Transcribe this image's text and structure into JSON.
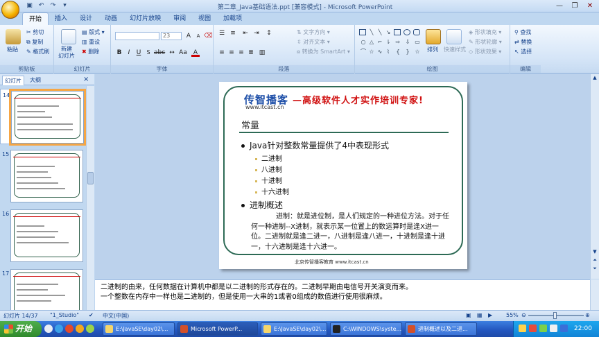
{
  "window": {
    "title": "第二章_Java基础语法.ppt [兼容模式] - Microsoft PowerPoint"
  },
  "tabs": [
    "开始",
    "插入",
    "设计",
    "动画",
    "幻灯片放映",
    "审阅",
    "视图",
    "加载项"
  ],
  "ribbon": {
    "clipboard": {
      "label": "剪贴板",
      "paste": "粘贴",
      "cut": "剪切",
      "copy": "复制",
      "format_painter": "格式刷"
    },
    "slides": {
      "label": "幻灯片",
      "new_slide": "新建\n幻灯片",
      "layout": "版式",
      "reset": "重设",
      "delete": "删除"
    },
    "font": {
      "label": "字体",
      "font_size": "23"
    },
    "paragraph": {
      "label": "段落",
      "text_direction": "文字方向",
      "align_text": "对齐文本",
      "smartart": "转换为 SmartArt"
    },
    "drawing": {
      "label": "绘图",
      "arrange": "排列",
      "quick_styles": "快速样式",
      "shape_fill": "形状填充",
      "shape_outline": "形状轮廓",
      "shape_effects": "形状效果"
    },
    "editing": {
      "label": "编辑",
      "find": "查找",
      "replace": "替换",
      "select": "选择"
    }
  },
  "pane": {
    "tab_slides": "幻灯片",
    "tab_outline": "大纲",
    "close": "×",
    "thumb_numbers": [
      "14",
      "15",
      "16",
      "17"
    ]
  },
  "slide": {
    "brand": "传智播客",
    "brand_url": "www.itcast.cn",
    "slogan": "—高级软件人才实作培训专家!",
    "title": "常量",
    "bullet1": "Java针对整数常量提供了4中表现形式",
    "sub_bullets": [
      "二进制",
      "八进制",
      "十进制",
      "十六进制"
    ],
    "bullet2": "进制概述",
    "paragraph": "进制：就是进位制，是人们规定的一种进位方法。对于任何一种进制--X进制，就表示某一位置上的数运算时是逢X进一位。二进制就是逢二进一，八进制是逢八进一，十进制是逢十进一，十六进制是逢十六进一。",
    "footer": "北京传智播客教育 www.itcast.cn"
  },
  "notes": {
    "line1": "二进制的由来，任何数据在计算机中都是以二进制的形式存在的。二进制早期由电信号开关演变而来。",
    "line2": "一个整数在内存中一样也是二进制的，但是使用一大串的1或者0组成的数值进行使用很麻烦。"
  },
  "status": {
    "slide": "幻灯片 14/37",
    "theme": "\"1_Studio\"",
    "lang": "中文(中国)",
    "zoom": "55%"
  },
  "taskbar": {
    "start": "开始",
    "items": [
      "E:\\JavaSE\\day02\\...",
      "Microsoft PowerP...",
      "E:\\JavaSE\\day02\\...",
      "C:\\WINDOWS\\syste...",
      "进制概述以及二进..."
    ],
    "clock": "22:00"
  },
  "colors": {
    "brand_blue": "#1e4fa8",
    "slogan_red": "#d01010",
    "frame_green": "#2d6a55",
    "selected_thumb": "#f6a645"
  }
}
